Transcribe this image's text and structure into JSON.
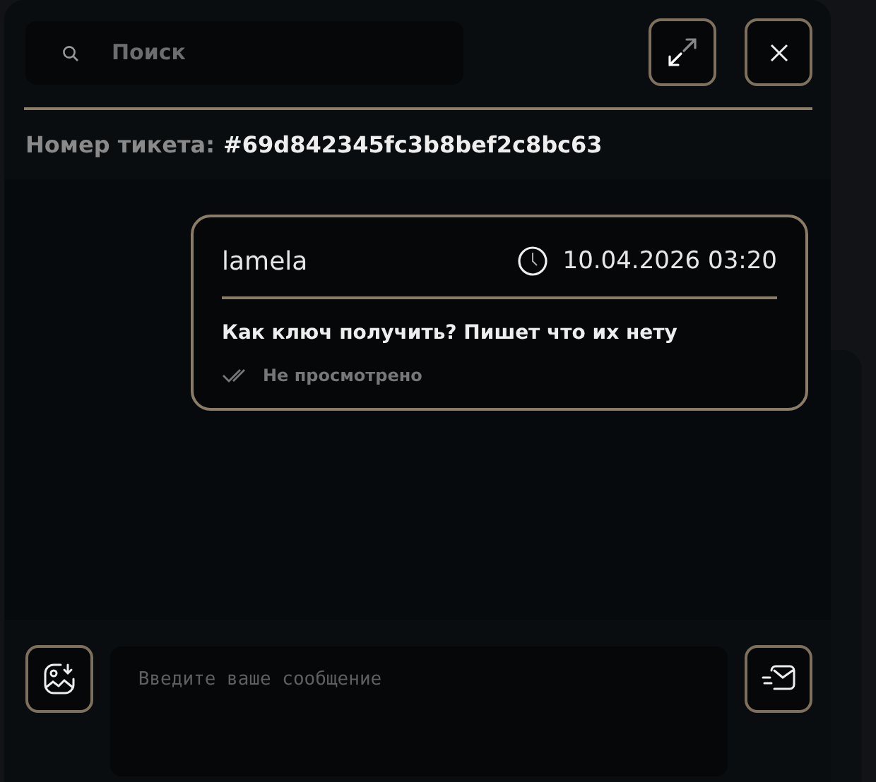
{
  "search": {
    "placeholder": "Поиск"
  },
  "ticket": {
    "label": "Номер тикета:",
    "number": "#69d842345fc3b8bef2c8bc63"
  },
  "messages": [
    {
      "author": "lamela",
      "time": "10.04.2026 03:20",
      "text": "Как ключ получить? Пишет что их нету",
      "status": "Не просмотрено",
      "seen": false
    }
  ],
  "composer": {
    "placeholder": "Введите ваше сообщение"
  }
}
